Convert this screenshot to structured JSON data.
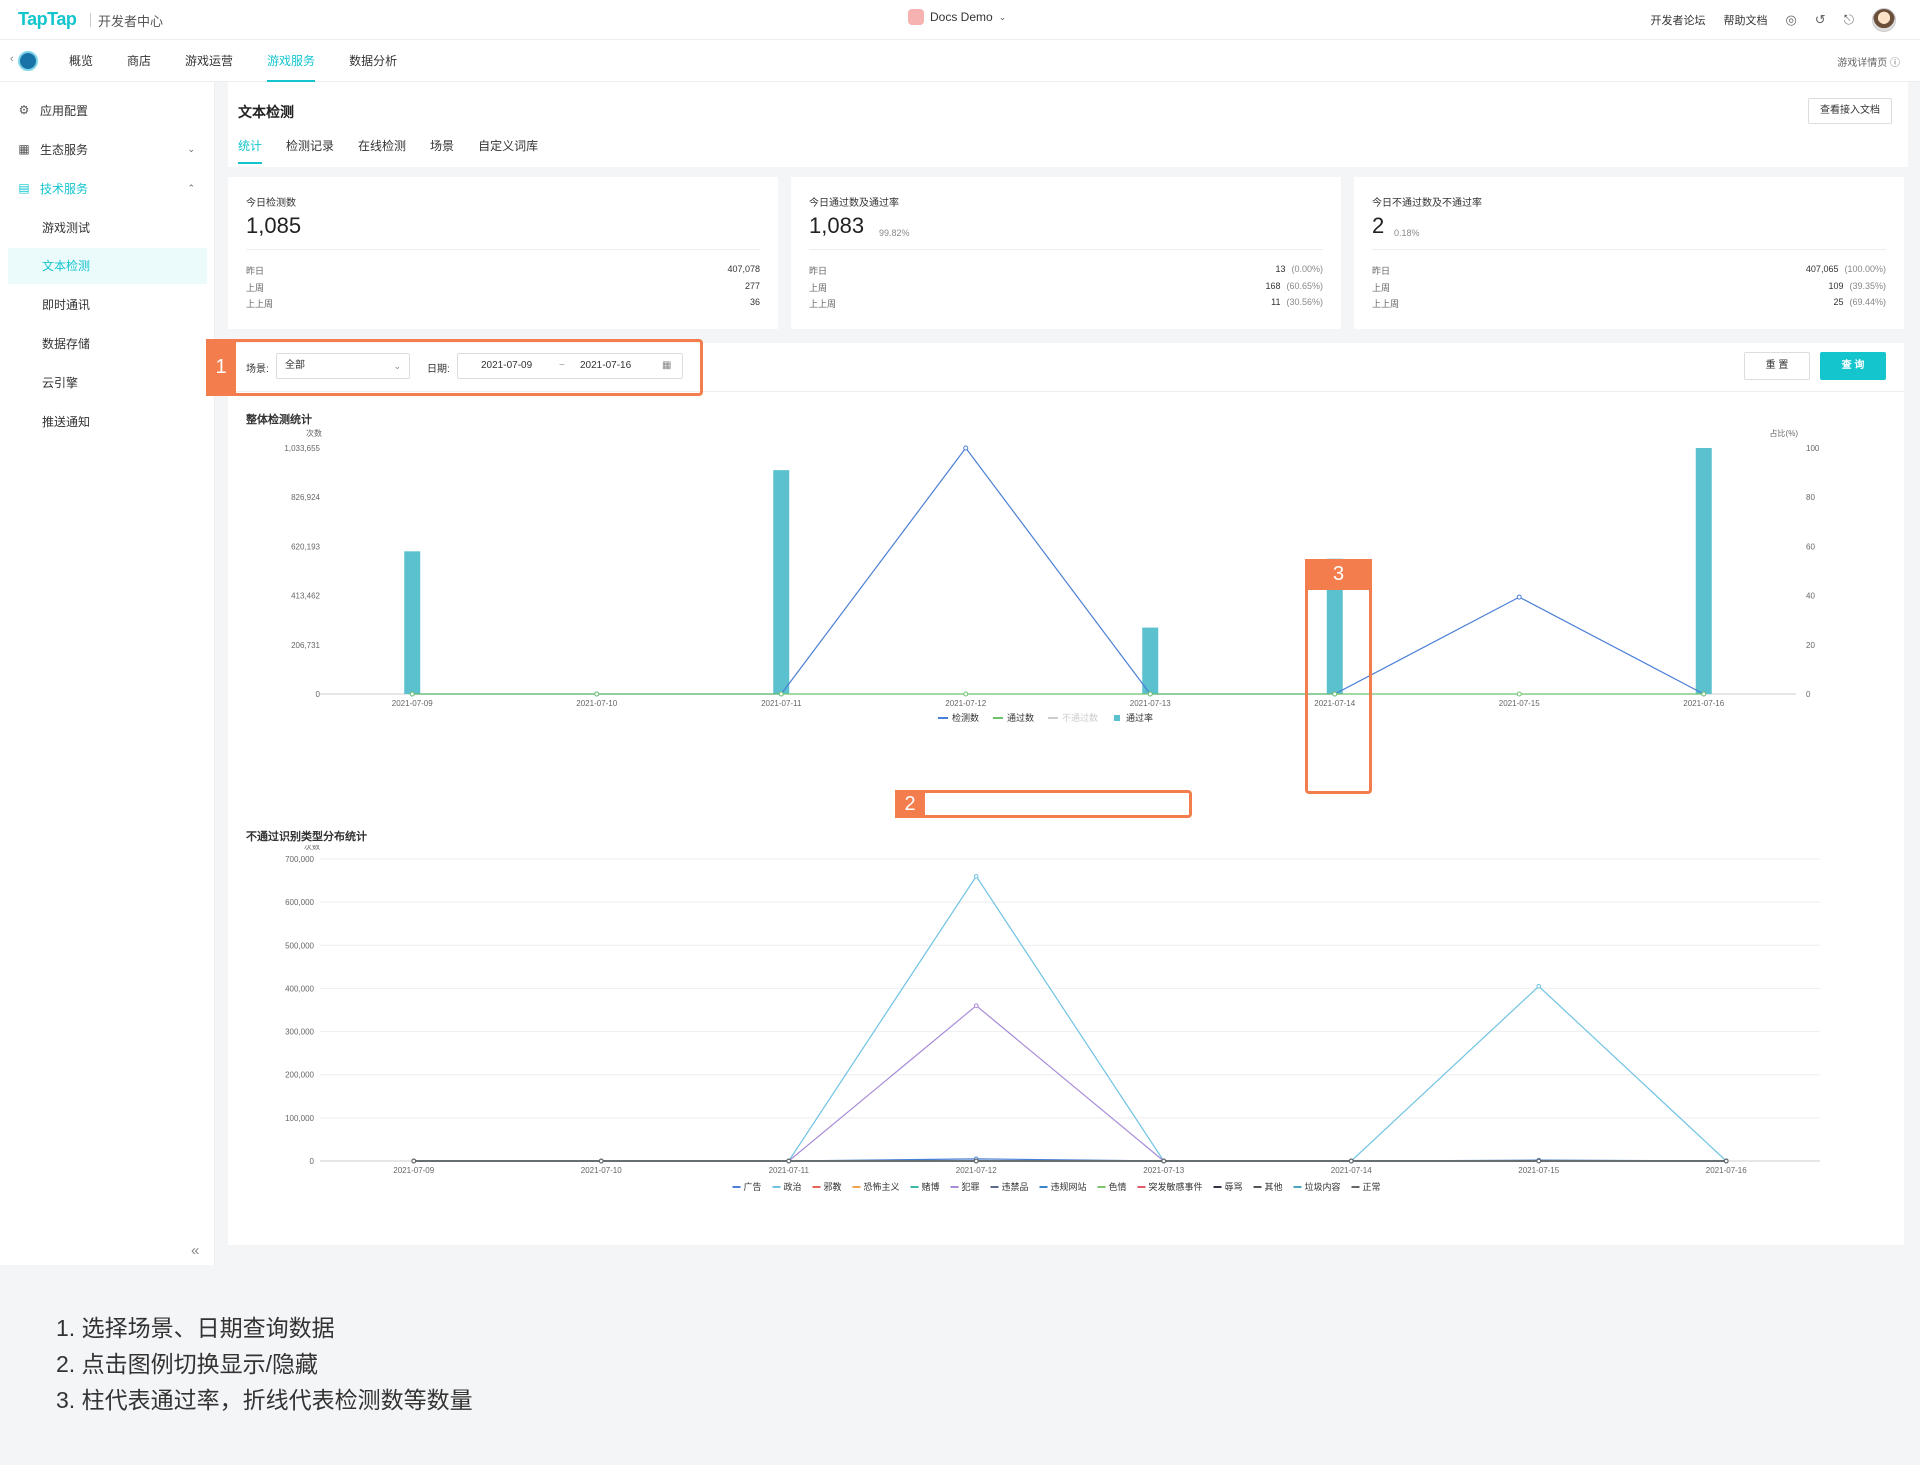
{
  "topbar": {
    "logo": "TapTap",
    "subtitle": "开发者中心",
    "app_name": "Docs Demo",
    "links": [
      "开发者论坛",
      "帮助文档"
    ],
    "icons": [
      "globe-icon",
      "headset-icon",
      "bell-icon"
    ]
  },
  "nav": {
    "tabs": [
      {
        "label": "概览",
        "active": false
      },
      {
        "label": "商店",
        "active": false
      },
      {
        "label": "游戏运营",
        "active": false
      },
      {
        "label": "游戏服务",
        "active": true
      },
      {
        "label": "数据分析",
        "active": false
      }
    ],
    "right_link": "游戏详情页 ⓘ"
  },
  "sidebar": {
    "items": [
      {
        "label": "应用配置",
        "icon": "gear-icon"
      },
      {
        "label": "生态服务",
        "icon": "chart-box-icon",
        "caret": "⌄"
      },
      {
        "label": "技术服务",
        "icon": "briefcase-icon",
        "caret": "⌃"
      }
    ],
    "sub_items": [
      "游戏测试",
      "文本检测",
      "即时通讯",
      "数据存储",
      "云引擎",
      "推送通知"
    ],
    "active_sub": "文本检测"
  },
  "page": {
    "title": "文本检测",
    "doc_button": "查看接入文档",
    "tabs": [
      "统计",
      "检测记录",
      "在线检测",
      "场景",
      "自定义词库"
    ],
    "active_tab": "统计"
  },
  "cards": [
    {
      "label": "今日检测数",
      "value": "1,085",
      "pct": "",
      "rows": [
        {
          "name": "昨日",
          "value": "407,078",
          "pct": ""
        },
        {
          "name": "上周",
          "value": "277",
          "pct": ""
        },
        {
          "name": "上上周",
          "value": "36",
          "pct": ""
        }
      ]
    },
    {
      "label": "今日通过数及通过率",
      "value": "1,083",
      "pct": "99.82%",
      "rows": [
        {
          "name": "昨日",
          "value": "13",
          "pct": "(0.00%)"
        },
        {
          "name": "上周",
          "value": "168",
          "pct": "(60.65%)"
        },
        {
          "name": "上上周",
          "value": "11",
          "pct": "(30.56%)"
        }
      ]
    },
    {
      "label": "今日不通过数及不通过率",
      "value": "2",
      "pct": "0.18%",
      "rows": [
        {
          "name": "昨日",
          "value": "407,065",
          "pct": "(100.00%)"
        },
        {
          "name": "上周",
          "value": "109",
          "pct": "(39.35%)"
        },
        {
          "name": "上上周",
          "value": "25",
          "pct": "(69.44%)"
        }
      ]
    }
  ],
  "filters": {
    "scene_label": "场景:",
    "scene_value": "全部",
    "date_label": "日期:",
    "date_from": "2021-07-09",
    "date_sep": "~",
    "date_to": "2021-07-16",
    "reset": "重 置",
    "query": "查 询"
  },
  "chart_data": [
    {
      "type": "bar",
      "title": "整体检测统计",
      "categories": [
        "2021-07-09",
        "2021-07-10",
        "2021-07-11",
        "2021-07-12",
        "2021-07-13",
        "2021-07-14",
        "2021-07-15",
        "2021-07-16"
      ],
      "ylabel": "次数",
      "ylabel_right": "占比(%)",
      "yticks": [
        "0",
        "206,731",
        "413,462",
        "620,193",
        "826,924",
        "1,033,655"
      ],
      "yticks_right": [
        "0",
        "20",
        "40",
        "60",
        "80",
        "100"
      ],
      "ylim": [
        0,
        1033655
      ],
      "ylim_right": [
        0,
        100
      ],
      "series": [
        {
          "name": "检测数",
          "kind": "line",
          "axis": "left",
          "color": "#4a7fd6",
          "values": [
            0,
            0,
            0,
            1033655,
            0,
            0,
            407078,
            0
          ]
        },
        {
          "name": "通过数",
          "kind": "line",
          "axis": "left",
          "color": "#6cc36c",
          "values": [
            0,
            0,
            0,
            0,
            0,
            0,
            0,
            0
          ]
        },
        {
          "name": "不通过数",
          "kind": "line",
          "axis": "left",
          "color": "#cccccc",
          "hidden": true,
          "values": [
            0,
            0,
            0,
            0,
            0,
            0,
            0,
            0
          ]
        },
        {
          "name": "通过率",
          "kind": "bar",
          "axis": "right",
          "color": "#5bc1cf",
          "values": [
            58,
            null,
            91,
            null,
            27,
            55,
            null,
            100
          ]
        }
      ],
      "legend_position": "bottom",
      "grid": false
    },
    {
      "type": "line",
      "title": "不通过识别类型分布统计",
      "categories": [
        "2021-07-09",
        "2021-07-10",
        "2021-07-11",
        "2021-07-12",
        "2021-07-13",
        "2021-07-14",
        "2021-07-15",
        "2021-07-16"
      ],
      "ylabel": "次数",
      "yticks": [
        "0",
        "100,000",
        "200,000",
        "300,000",
        "400,000",
        "500,000",
        "600,000",
        "700,000"
      ],
      "ylim": [
        0,
        700000
      ],
      "series": [
        {
          "name": "广告",
          "color": "#4a7fd6",
          "values": [
            0,
            0,
            0,
            5000,
            0,
            0,
            2000,
            0
          ]
        },
        {
          "name": "政治",
          "color": "#6fc3e3",
          "values": [
            0,
            0,
            0,
            660000,
            0,
            0,
            405000,
            0
          ]
        },
        {
          "name": "邪教",
          "color": "#e8625c",
          "values": [
            0,
            0,
            0,
            0,
            0,
            0,
            0,
            0
          ]
        },
        {
          "name": "恐怖主义",
          "color": "#f0a44d",
          "values": [
            0,
            0,
            0,
            0,
            0,
            0,
            0,
            0
          ]
        },
        {
          "name": "赌博",
          "color": "#3bb8a8",
          "values": [
            0,
            0,
            0,
            0,
            0,
            0,
            0,
            0
          ]
        },
        {
          "name": "犯罪",
          "color": "#a78bd8",
          "values": [
            0,
            0,
            0,
            360000,
            0,
            0,
            0,
            0
          ]
        },
        {
          "name": "违禁品",
          "color": "#5b6c8f",
          "values": [
            0,
            0,
            0,
            0,
            0,
            0,
            0,
            0
          ]
        },
        {
          "name": "违规网站",
          "color": "#3a86c8",
          "values": [
            0,
            0,
            0,
            0,
            0,
            0,
            0,
            0
          ]
        },
        {
          "name": "色情",
          "color": "#7cc56b",
          "values": [
            0,
            0,
            0,
            0,
            0,
            0,
            0,
            0
          ]
        },
        {
          "name": "突发敏感事件",
          "color": "#e05c6a",
          "values": [
            0,
            0,
            0,
            0,
            0,
            0,
            0,
            0
          ]
        },
        {
          "name": "辱骂",
          "color": "#333344",
          "values": [
            0,
            0,
            0,
            0,
            0,
            0,
            0,
            0
          ]
        },
        {
          "name": "其他",
          "color": "#555555",
          "values": [
            0,
            0,
            0,
            0,
            0,
            0,
            0,
            0
          ]
        },
        {
          "name": "垃圾内容",
          "color": "#4aa3b8",
          "values": [
            0,
            0,
            0,
            0,
            0,
            0,
            0,
            0
          ]
        },
        {
          "name": "正常",
          "color": "#666666",
          "values": [
            0,
            0,
            0,
            0,
            0,
            0,
            0,
            0
          ]
        }
      ],
      "legend_position": "bottom",
      "grid": true
    }
  ],
  "annotations": [
    "1",
    "2",
    "3"
  ],
  "notes": [
    "1. 选择场景、日期查询数据",
    "2. 点击图例切换显示/隐藏",
    "3. 柱代表通过率，折线代表检测数等数量"
  ],
  "colors": {
    "accent": "#15c5ce",
    "annotation": "#f47d4d"
  }
}
